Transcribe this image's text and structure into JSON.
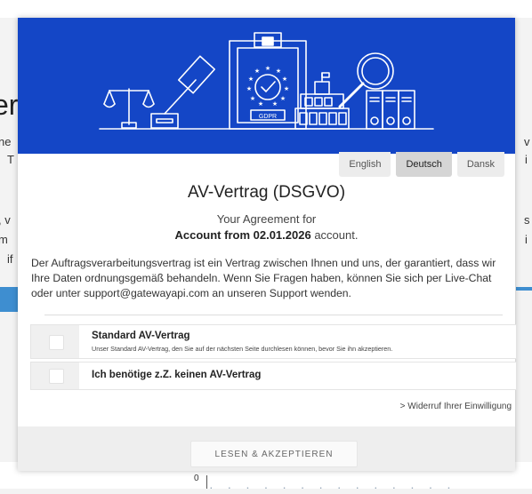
{
  "background": {
    "title_fragment": "er",
    "line_fragments": [
      "ne",
      "T",
      ", v",
      "m",
      "if"
    ],
    "right_fragments": [
      "v",
      "i",
      "s",
      "i"
    ],
    "bottom_fragment": "0",
    "accent_color": "#3e8ed0"
  },
  "banner": {
    "bg_color": "#1446c6",
    "gdpr_label": "GDPR",
    "icons": [
      "scales-icon",
      "gavel-icon",
      "gdpr-clipboard-icon",
      "building-icon",
      "magnifier-icon",
      "binders-icon"
    ]
  },
  "languages": {
    "tabs": [
      {
        "label": "English",
        "active": false
      },
      {
        "label": "Deutsch",
        "active": true
      },
      {
        "label": "Dansk",
        "active": false
      }
    ]
  },
  "dialog": {
    "title": "AV-Vertrag (DSGVO)",
    "subtitle": "Your Agreement for",
    "account_bold": "Account from 02.01.2026",
    "account_suffix": " account.",
    "description": "Der Auftragsverarbeitungsvertrag ist ein Vertrag zwischen Ihnen und uns, der garantiert, dass wir Ihre Daten ordnungsgemäß behandeln. Wenn Sie Fragen haben, können Sie sich per Live-Chat oder unter support@gatewayapi.com an unseren Support wenden."
  },
  "options": [
    {
      "title": "Standard AV-Vertrag",
      "subtitle": "Unser Standard AV-Vertrag, den Sie auf der nächsten Seite durchlesen können, bevor Sie ihn akzeptieren.",
      "checked": false
    },
    {
      "title": "Ich benötige z.Z. keinen AV-Vertrag",
      "checked": false
    }
  ],
  "withdraw_link": "> Widerruf Ihrer Einwilligung",
  "footer": {
    "accept_label": "LESEN & AKZEPTIEREN"
  }
}
